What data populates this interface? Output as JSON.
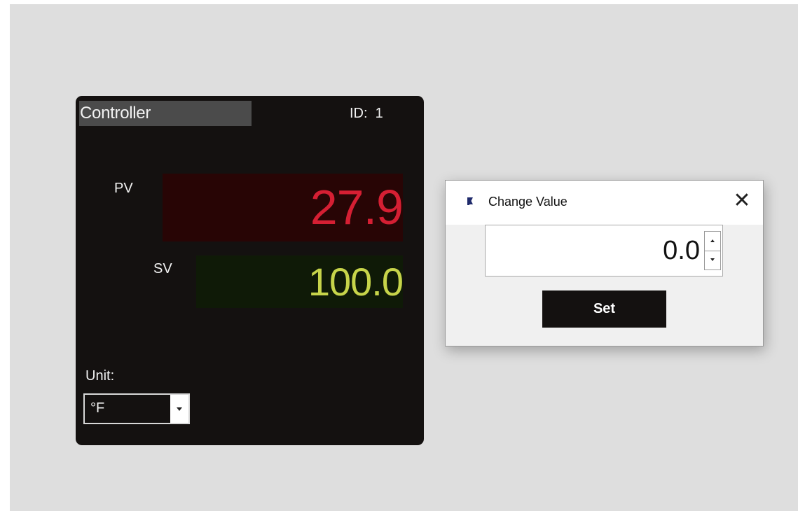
{
  "controller": {
    "title": "Controller",
    "id_label": "ID:  1",
    "pv_label": "PV",
    "pv_value": "27.9",
    "sv_label": "SV",
    "sv_value": "100.0",
    "unit_label": "Unit:",
    "unit_selected": "°F",
    "colors": {
      "panel_bg": "#141110",
      "pv_text": "#d51f33",
      "pv_bg": "#280505",
      "sv_text": "#c7d44a",
      "sv_bg": "#0f1a07"
    }
  },
  "dialog": {
    "title": "Change Value",
    "icon": "flag-icon",
    "close_icon": "close-icon",
    "spin_value": "0.0",
    "set_label": "Set"
  }
}
